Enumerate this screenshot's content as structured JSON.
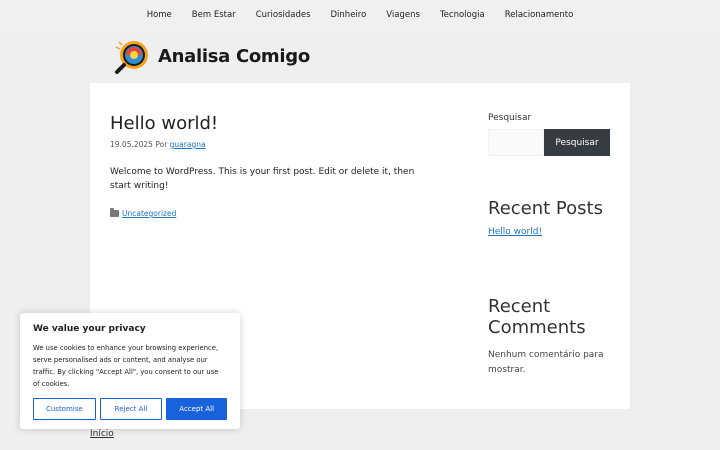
{
  "nav": {
    "items": [
      "Home",
      "Bem Estar",
      "Curiosidades",
      "Dinheiro",
      "Viagens",
      "Tecnologia",
      "Relacionamento"
    ]
  },
  "header": {
    "brand": "Analisa Comigo",
    "logo_icon": "magnifier-logo-icon"
  },
  "post": {
    "title": "Hello world!",
    "date": "19.05.2025",
    "by_label": "Por",
    "author": "guaragna",
    "body": "Welcome to WordPress. This is your first post. Edit or delete it, then start writing!",
    "category": "Uncategorized"
  },
  "sidebar": {
    "search_label": "Pesquisar",
    "search_button": "Pesquisar",
    "recent_posts_title": "Recent Posts",
    "recent_posts": [
      "Hello world!"
    ],
    "recent_comments_title": "Recent Comments",
    "no_comments": "Nenhum comentário para mostrar."
  },
  "footer": {
    "link": "Início"
  },
  "cookie": {
    "title": "We value your privacy",
    "text": "We use cookies to enhance your browsing experience, serve personalised ads or content, and analyse our traffic. By clicking \"Accept All\", you consent to our use of cookies.",
    "customise": "Customise",
    "reject": "Reject All",
    "accept": "Accept All",
    "accent": "#1863dc"
  },
  "colors": {
    "link": "#1e73be",
    "button": "#373c42",
    "background": "#efefef"
  }
}
